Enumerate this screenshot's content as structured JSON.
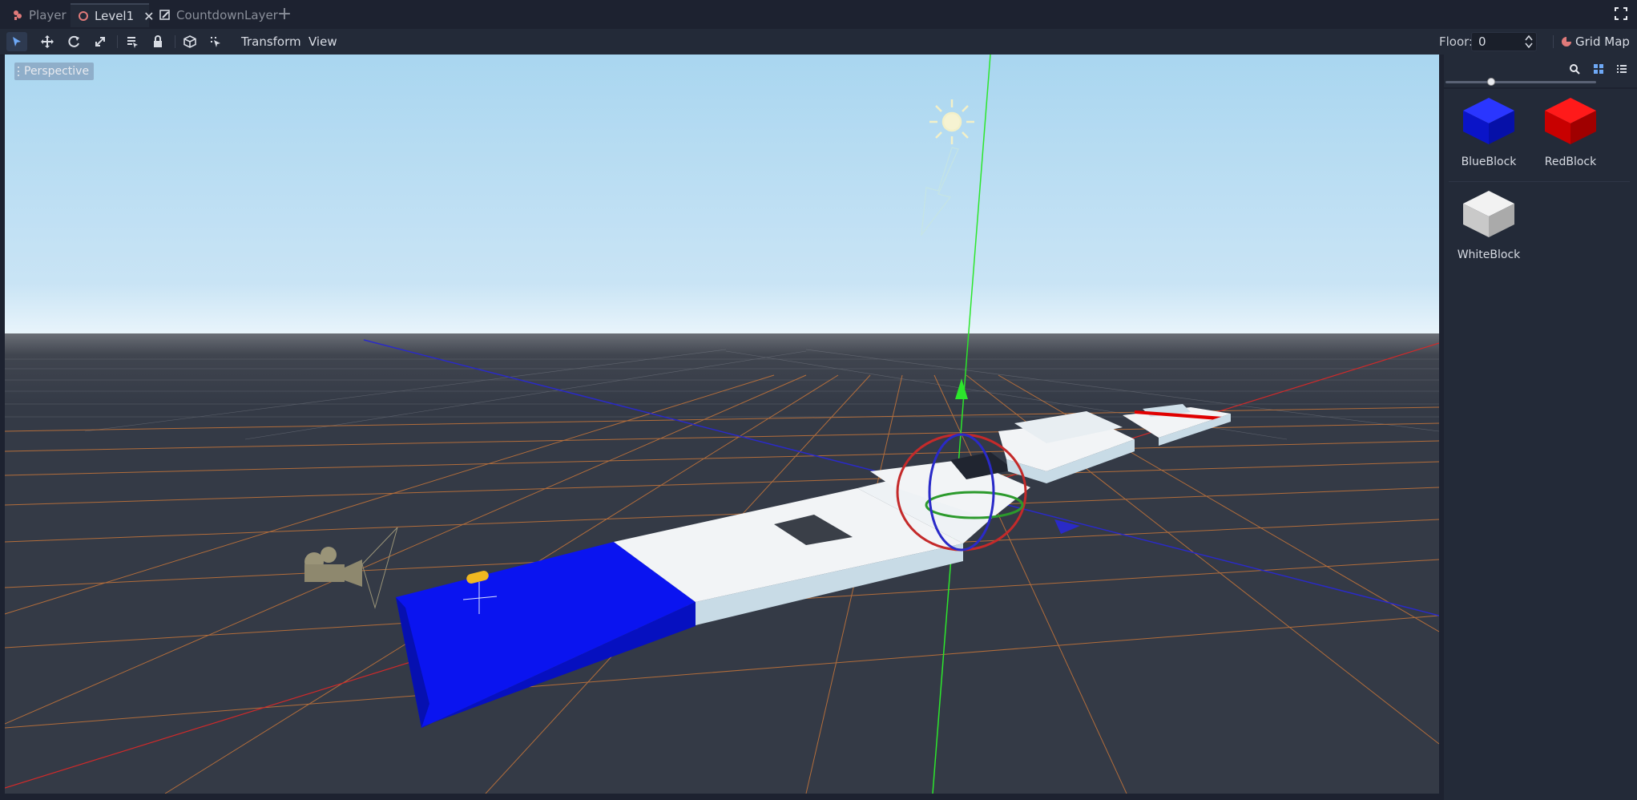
{
  "tabs": [
    {
      "label": "Player",
      "icon": "player-scene-icon",
      "active": false
    },
    {
      "label": "Level1",
      "icon": "level-scene-icon",
      "active": true
    },
    {
      "label": "CountdownLayer",
      "icon": "control-scene-icon",
      "active": false
    }
  ],
  "toolbar": {
    "transform_menu": "Transform",
    "view_menu": "View",
    "floor_label": "Floor:",
    "floor_value": "0",
    "grid_map_label": "Grid Map"
  },
  "viewport": {
    "view_label": "Perspective"
  },
  "palette": {
    "items": [
      {
        "label": "BlueBlock",
        "color": "#0a14f0"
      },
      {
        "label": "RedBlock",
        "color": "#e00000"
      },
      {
        "label": "WhiteBlock",
        "color": "#f2f2f2"
      }
    ]
  },
  "colors": {
    "accent": "#6ea8f5",
    "sky_top": "#a9d6f0",
    "floor": "#343a46",
    "grid_orange": "#c8763a",
    "axis_green": "#2ce62c",
    "axis_red": "#d02a2a",
    "axis_blue": "#2a2ac8"
  }
}
